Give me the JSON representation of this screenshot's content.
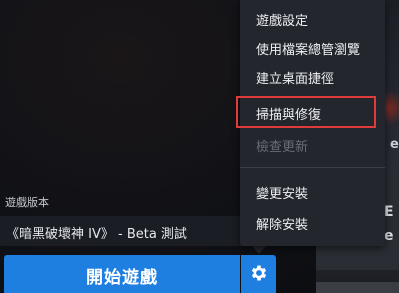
{
  "menu": {
    "items": [
      {
        "label": "遊戲設定",
        "enabled": true
      },
      {
        "label": "使用檔案總管瀏覽",
        "enabled": true
      },
      {
        "label": "建立桌面捷徑",
        "enabled": true
      },
      {
        "label": "掃描與修復",
        "enabled": true,
        "highlighted": true
      },
      {
        "label": "檢查更新",
        "enabled": false
      },
      {
        "label": "變更安裝",
        "enabled": true
      },
      {
        "label": "解除安裝",
        "enabled": true
      }
    ]
  },
  "version": {
    "label": "遊戲版本",
    "selected": "《暗黑破壞神 IV》 - Beta 測試"
  },
  "play_button": {
    "label": "開始遊戲"
  },
  "gear_button": {
    "icon": "gear-icon"
  },
  "background_text": {
    "a": "E",
    "b": "e",
    "c": "e"
  },
  "colors": {
    "accent": "#1f7fe0",
    "menu_bg": "#24262e",
    "highlight_border": "#e03b3b",
    "disabled_text": "#6a6d77"
  }
}
